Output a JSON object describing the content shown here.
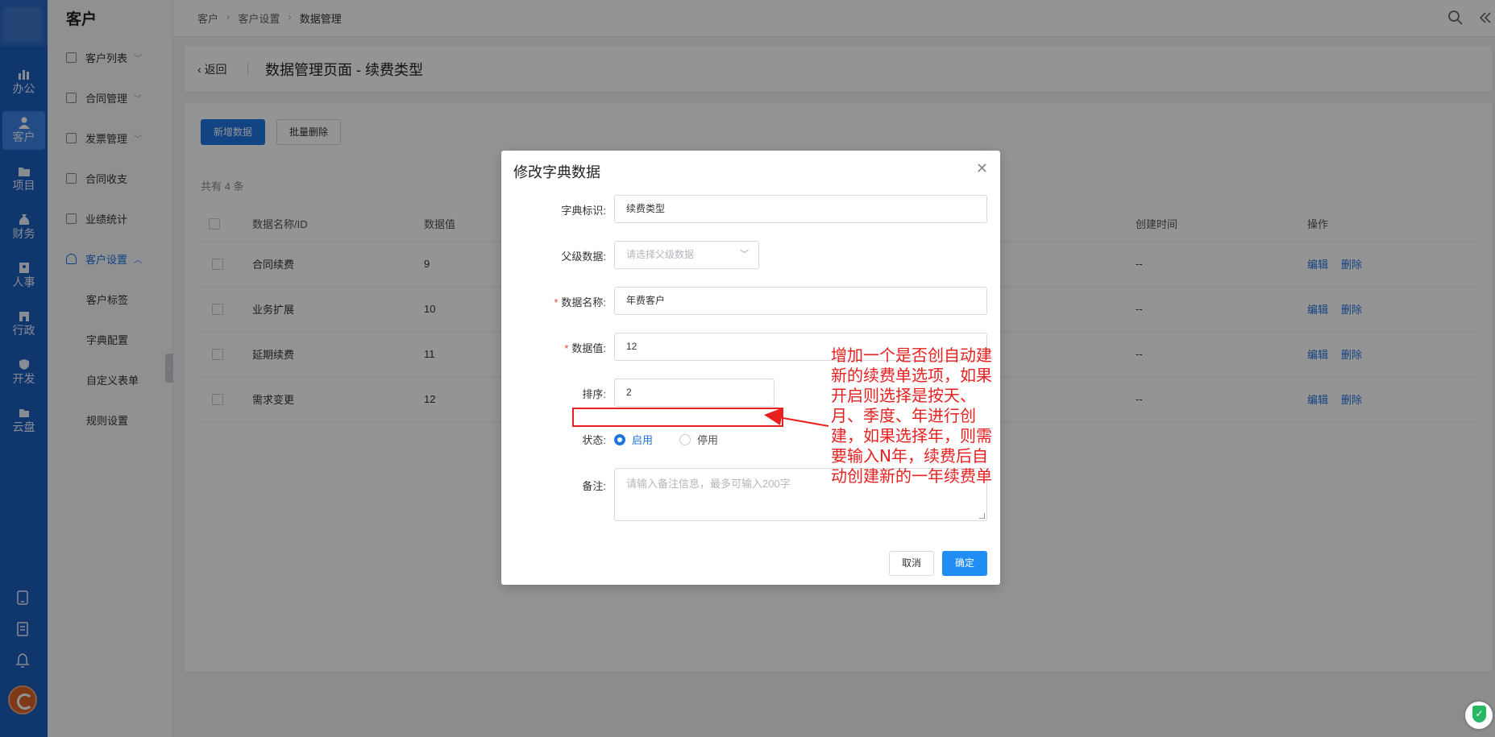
{
  "rail": {
    "items": [
      {
        "label": "办公",
        "icon": "chart-icon",
        "active": false
      },
      {
        "label": "客户",
        "icon": "customer-icon",
        "active": true
      },
      {
        "label": "项目",
        "icon": "folder-icon",
        "active": false
      },
      {
        "label": "财务",
        "icon": "money-bag-icon",
        "active": false
      },
      {
        "label": "人事",
        "icon": "badge-icon",
        "active": false
      },
      {
        "label": "行政",
        "icon": "building-icon",
        "active": false
      },
      {
        "label": "开发",
        "icon": "shield-icon",
        "active": false
      },
      {
        "label": "云盘",
        "icon": "cloud-drive-icon",
        "active": false
      }
    ],
    "bottom_icons": [
      "phone-icon",
      "book-icon",
      "bell-icon"
    ]
  },
  "sidebar": {
    "title": "客户",
    "items": [
      {
        "label": "客户列表",
        "expandable": true
      },
      {
        "label": "合同管理",
        "expandable": true
      },
      {
        "label": "发票管理",
        "expandable": true
      },
      {
        "label": "合同收支",
        "expandable": false
      },
      {
        "label": "业绩统计",
        "expandable": false
      },
      {
        "label": "客户设置",
        "expandable": true,
        "active": true
      }
    ],
    "sub_items": [
      "客户标签",
      "字典配置",
      "自定义表单",
      "规则设置"
    ]
  },
  "breadcrumb": [
    "客户",
    "客户设置",
    "数据管理"
  ],
  "header": {
    "back_label": "返回",
    "title": "数据管理页面 - 续费类型"
  },
  "toolbar": {
    "add_label": "新增数据",
    "batch_delete_label": "批量删除"
  },
  "table": {
    "total_text": "共有 4 条",
    "columns": [
      "数据名称/ID",
      "数据值",
      "创建时间",
      "操作"
    ],
    "rows": [
      {
        "name": "合同续费",
        "value": "9",
        "created": "--"
      },
      {
        "name": "业务扩展",
        "value": "10",
        "created": "--"
      },
      {
        "name": "延期续费",
        "value": "11",
        "created": "--"
      },
      {
        "name": "需求变更",
        "value": "12",
        "created": "--"
      }
    ],
    "edit_label": "编辑",
    "delete_label": "删除"
  },
  "dialog": {
    "title": "修改字典数据",
    "fields": {
      "dict_key": {
        "label": "字典标识:",
        "value": "续费类型"
      },
      "parent": {
        "label": "父级数据:",
        "placeholder": "请选择父级数据"
      },
      "name": {
        "label": "数据名称:",
        "value": "年费客户"
      },
      "value": {
        "label": "数据值:",
        "value": "12"
      },
      "sort": {
        "label": "排序:",
        "value": "2"
      },
      "status": {
        "label": "状态:",
        "options": [
          "启用",
          "停用"
        ],
        "selected": "启用"
      },
      "remark": {
        "label": "备注:",
        "placeholder": "请输入备注信息，最多可输入200字"
      }
    },
    "cancel_label": "取消",
    "ok_label": "确定"
  },
  "annotation": {
    "text": "增加一个是否创自动建新的续费单选项，如果开启则选择是按天、月、季度、年进行创建，如果选择年，则需要输入N年，续费后自动创建新的一年续费单",
    "color": "#e82020"
  },
  "colors": {
    "rail": "#1c5dbe",
    "primary": "#1f74e0",
    "annotation": "#e82020"
  }
}
